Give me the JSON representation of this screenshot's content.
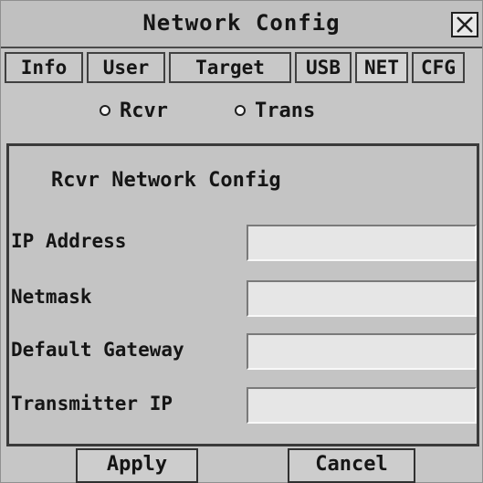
{
  "window": {
    "title": "Network Config",
    "close_label": "X"
  },
  "tabs": [
    {
      "label": "Info"
    },
    {
      "label": "User"
    },
    {
      "label": "Target"
    },
    {
      "label": "USB"
    },
    {
      "label": "NET"
    },
    {
      "label": "CFG"
    }
  ],
  "mode": {
    "options": [
      {
        "label": "Rcvr"
      },
      {
        "label": "Trans"
      }
    ]
  },
  "panel": {
    "title": "Rcvr Network Config",
    "fields": [
      {
        "label": "IP Address",
        "value": ""
      },
      {
        "label": "Netmask",
        "value": ""
      },
      {
        "label": "Default Gateway",
        "value": ""
      },
      {
        "label": "Transmitter IP",
        "value": ""
      }
    ]
  },
  "actions": {
    "apply_label": "Apply",
    "cancel_label": "Cancel"
  }
}
